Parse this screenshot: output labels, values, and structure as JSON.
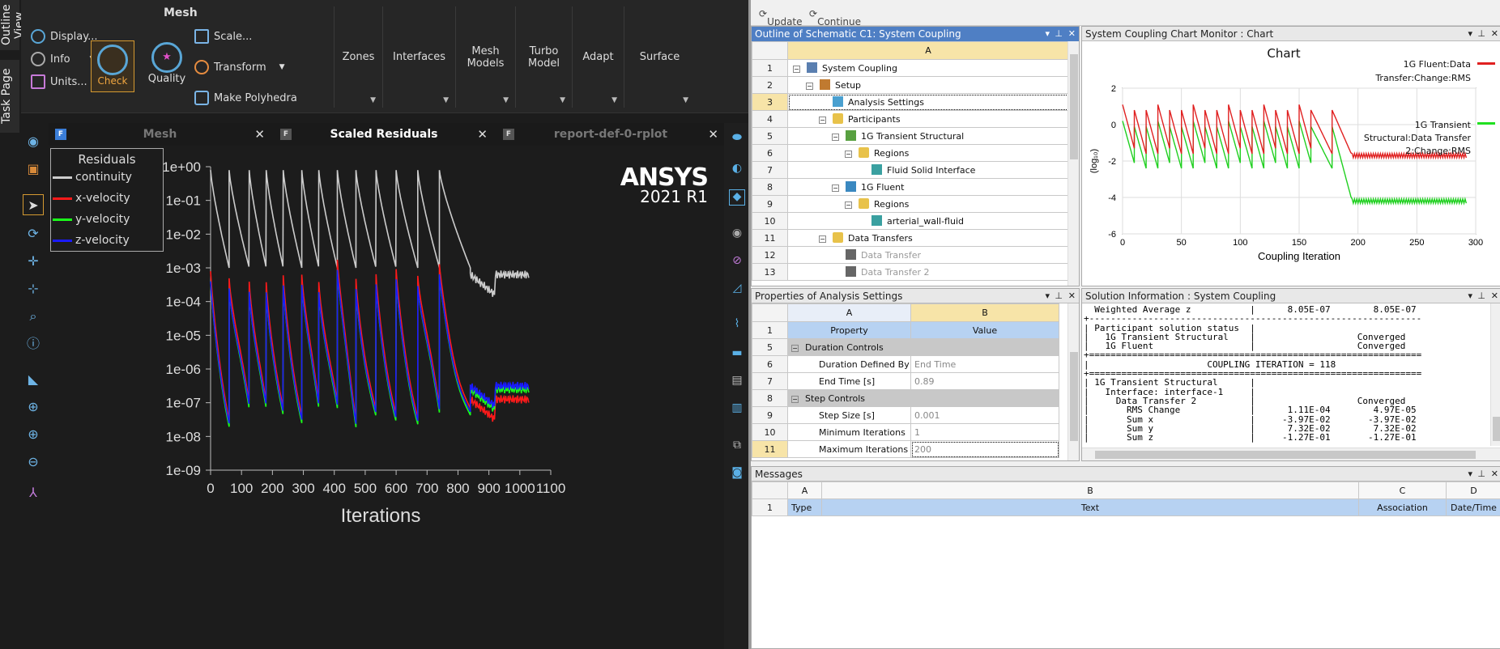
{
  "side_tabs": {
    "outline": "Outline View",
    "task": "Task Page"
  },
  "ribbon": {
    "title": "Mesh",
    "display": "Display...",
    "info": "Info",
    "units": "Units...",
    "check": "Check",
    "quality": "Quality",
    "scale": "Scale...",
    "transform": "Transform",
    "polyhedra": "Make Polyhedra",
    "sections": [
      "Zones",
      "Interfaces",
      "Mesh\nModels",
      "Turbo\nModel",
      "Adapt",
      "Surface"
    ]
  },
  "tabs": [
    {
      "label": "Mesh",
      "icon": "F"
    },
    {
      "label": "Scaled Residuals",
      "icon": "F"
    },
    {
      "label": "report-def-0-rplot",
      "icon": "F"
    }
  ],
  "residuals": {
    "legend_title": "Residuals",
    "series": [
      {
        "name": "continuity",
        "color": "#cccccc"
      },
      {
        "name": "x-velocity",
        "color": "#ff1a1a"
      },
      {
        "name": "y-velocity",
        "color": "#1aff1a"
      },
      {
        "name": "z-velocity",
        "color": "#1a1aff"
      }
    ],
    "brand": "ANSYS",
    "version": "2021 R1",
    "ylabels": [
      "1e+00",
      "1e-01",
      "1e-02",
      "1e-03",
      "1e-04",
      "1e-05",
      "1e-06",
      "1e-07",
      "1e-08",
      "1e-09"
    ],
    "xlabels": [
      "0",
      "100",
      "200",
      "300",
      "400",
      "500",
      "600",
      "700",
      "800",
      "900",
      "1000",
      "1100"
    ],
    "xlabel": "Iterations"
  },
  "toolbar": {
    "update": "Update",
    "continue": "Continue Calculation"
  },
  "outline": {
    "title": "Outline of Schematic C1: System Coupling",
    "col": "A",
    "rows": [
      {
        "n": "1",
        "label": "System Coupling",
        "indent": 0,
        "exp": "⊟",
        "icon": "sys"
      },
      {
        "n": "2",
        "label": "Setup",
        "indent": 1,
        "exp": "⊟",
        "icon": "setup"
      },
      {
        "n": "3",
        "label": "Analysis Settings",
        "indent": 2,
        "exp": "",
        "icon": "set"
      },
      {
        "n": "4",
        "label": "Participants",
        "indent": 2,
        "exp": "⊟",
        "icon": "folder"
      },
      {
        "n": "5",
        "label": "1G Transient Structural",
        "indent": 3,
        "exp": "⊟",
        "icon": "struct"
      },
      {
        "n": "6",
        "label": "Regions",
        "indent": 4,
        "exp": "⊟",
        "icon": "folder"
      },
      {
        "n": "7",
        "label": "Fluid Solid Interface",
        "indent": 5,
        "exp": "",
        "icon": "cube"
      },
      {
        "n": "8",
        "label": "1G Fluent",
        "indent": 3,
        "exp": "⊟",
        "icon": "fluent"
      },
      {
        "n": "9",
        "label": "Regions",
        "indent": 4,
        "exp": "⊟",
        "icon": "folder"
      },
      {
        "n": "10",
        "label": "arterial_wall-fluid",
        "indent": 5,
        "exp": "",
        "icon": "cube"
      },
      {
        "n": "11",
        "label": "Data Transfers",
        "indent": 2,
        "exp": "⊟",
        "icon": "folder"
      },
      {
        "n": "12",
        "label": "Data Transfer",
        "indent": 3,
        "exp": "",
        "icon": "xfer",
        "grey": true
      },
      {
        "n": "13",
        "label": "Data Transfer 2",
        "indent": 3,
        "exp": "",
        "icon": "xfer",
        "grey": true
      }
    ]
  },
  "chart_monitor": {
    "title": "System Coupling Chart Monitor : Chart",
    "chart_title": "Chart",
    "legend1": "1G Fluent:Data Transfer:Change:RMS",
    "legend2": "1G Transient Structural:Data Transfer 2:Change:RMS",
    "ylabel": "(log₁₀)",
    "xlabel": "Coupling Iteration",
    "yticks": [
      "2",
      "0",
      "-2",
      "-4",
      "-6"
    ],
    "xticks": [
      "0",
      "50",
      "100",
      "150",
      "200",
      "250",
      "300"
    ]
  },
  "properties": {
    "title": "Properties of Analysis Settings",
    "colA": "A",
    "colB": "B",
    "rows": [
      {
        "n": "1",
        "a": "Property",
        "b": "Value",
        "type": "header"
      },
      {
        "n": "5",
        "a": "Duration Controls",
        "b": "",
        "type": "group"
      },
      {
        "n": "6",
        "a": "Duration Defined By",
        "b": "End Time",
        "type": "row"
      },
      {
        "n": "7",
        "a": "End Time [s]",
        "b": "0.89",
        "type": "row"
      },
      {
        "n": "8",
        "a": "Step Controls",
        "b": "",
        "type": "group"
      },
      {
        "n": "9",
        "a": "Step Size [s]",
        "b": "0.001",
        "type": "row"
      },
      {
        "n": "10",
        "a": "Minimum Iterations",
        "b": "1",
        "type": "row"
      },
      {
        "n": "11",
        "a": "Maximum Iterations",
        "b": "200",
        "type": "row",
        "sel": true
      }
    ]
  },
  "solution": {
    "title": "Solution Information : System Coupling",
    "lines": [
      "  Weighted Average z           |      8.05E-07        8.05E-07",
      "+--------------------------------------------------------------",
      "| Participant solution status  |",
      "|   1G Transient Structural    |                   Converged",
      "|   1G Fluent                  |                   Converged",
      "+==============================================================",
      "|                      COUPLING ITERATION = 118",
      "+==============================================================",
      "| 1G Transient Structural      |",
      "|   Interface: interface-1     |",
      "|     Data Transfer 2          |                   Converged",
      "|       RMS Change             |      1.11E-04        4.97E-05",
      "|       Sum x                  |     -3.97E-02       -3.97E-02",
      "|       Sum y                  |      7.32E-02        7.32E-02",
      "|       Sum z                  |     -1.27E-01       -1.27E-01"
    ]
  },
  "messages": {
    "title": "Messages",
    "cols": [
      "A",
      "B",
      "C",
      "D"
    ],
    "headers": [
      "Type",
      "Text",
      "Association",
      "Date/Time"
    ]
  }
}
